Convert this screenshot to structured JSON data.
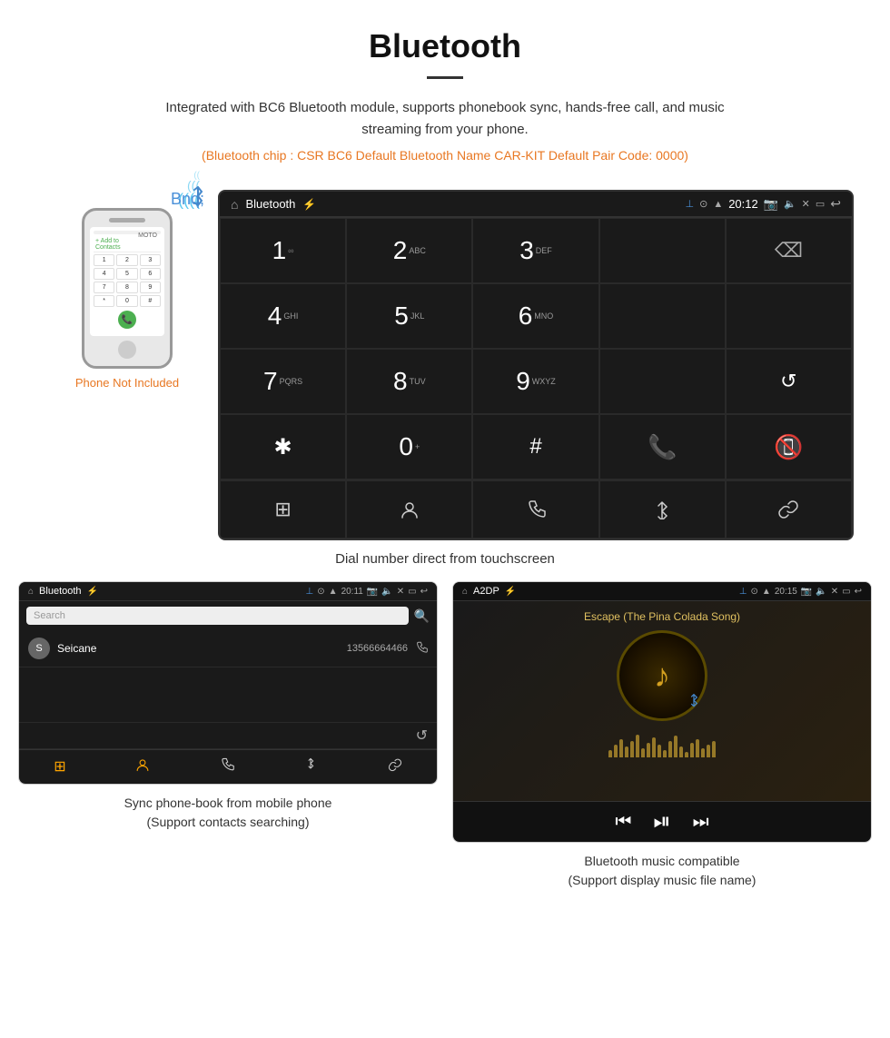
{
  "header": {
    "title": "Bluetooth",
    "description": "Integrated with BC6 Bluetooth module, supports phonebook sync, hands-free call, and music streaming from your phone.",
    "specs": "(Bluetooth chip : CSR BC6    Default Bluetooth Name CAR-KIT    Default Pair Code: 0000)"
  },
  "phone_label": "Phone Not Included",
  "dial_screen": {
    "title": "Bluetooth",
    "usb_icon": "⌀",
    "time": "20:12",
    "caption": "Dial number direct from touchscreen",
    "keys": [
      {
        "num": "1",
        "letters": "∞"
      },
      {
        "num": "2",
        "letters": "ABC"
      },
      {
        "num": "3",
        "letters": "DEF"
      },
      {
        "num": "",
        "letters": ""
      },
      {
        "num": "⌫",
        "letters": ""
      },
      {
        "num": "4",
        "letters": "GHI"
      },
      {
        "num": "5",
        "letters": "JKL"
      },
      {
        "num": "6",
        "letters": "MNO"
      },
      {
        "num": "",
        "letters": ""
      },
      {
        "num": "",
        "letters": ""
      },
      {
        "num": "7",
        "letters": "PQRS"
      },
      {
        "num": "8",
        "letters": "TUV"
      },
      {
        "num": "9",
        "letters": "WXYZ"
      },
      {
        "num": "",
        "letters": ""
      },
      {
        "num": "↺",
        "letters": ""
      },
      {
        "num": "*",
        "letters": ""
      },
      {
        "num": "0",
        "letters": "+"
      },
      {
        "num": "#",
        "letters": ""
      },
      {
        "num": "📞",
        "letters": ""
      },
      {
        "num": "📵",
        "letters": ""
      }
    ],
    "bottom_icons": [
      "⊞",
      "👤",
      "📞",
      "✴",
      "🔗"
    ]
  },
  "phonebook_screen": {
    "title": "Bluetooth",
    "time": "20:11",
    "search_placeholder": "Search",
    "contact": {
      "letter": "S",
      "name": "Seicane",
      "number": "13566664466"
    },
    "caption": "Sync phone-book from mobile phone",
    "caption2": "(Support contacts searching)"
  },
  "music_screen": {
    "title": "A2DP",
    "time": "20:15",
    "song": "Escape (The Pina Colada Song)",
    "caption": "Bluetooth music compatible",
    "caption2": "(Support display music file name)"
  }
}
